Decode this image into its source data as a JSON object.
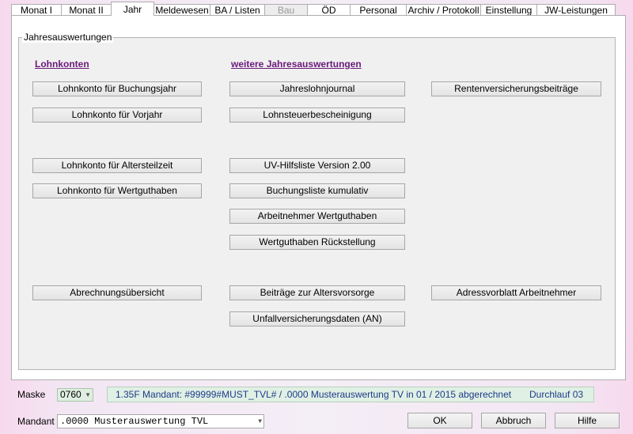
{
  "tabs": [
    {
      "label": "Monat I"
    },
    {
      "label": "Monat II"
    },
    {
      "label": "Jahr"
    },
    {
      "label": "Meldewesen"
    },
    {
      "label": "BA / Listen"
    },
    {
      "label": "Bau"
    },
    {
      "label": "ÖD"
    },
    {
      "label": "Personal"
    },
    {
      "label": "Archiv / Protokoll"
    },
    {
      "label": "Einstellung"
    },
    {
      "label": "JW-Leistungen"
    }
  ],
  "group": {
    "title": "Jahresauswertungen"
  },
  "sections": {
    "lohnkonten": "Lohnkonten",
    "weitere": "weitere Jahresauswertungen"
  },
  "buttons": {
    "lk_buchungsjahr": "Lohnkonto für Buchungsjahr",
    "lk_vorjahr": "Lohnkonto für Vorjahr",
    "lk_altersteilzeit": "Lohnkonto für Altersteilzeit",
    "lk_wertguthaben": "Lohnkonto für Wertguthaben",
    "abrechnungsuebersicht": "Abrechnungsübersicht",
    "jahreslohnjournal": "Jahreslohnjournal",
    "lohnsteuerbescheinigung": "Lohnsteuerbescheinigung",
    "uv_hilfsliste": "UV-Hilfsliste Version 2.00",
    "buchungsliste": "Buchungsliste kumulativ",
    "an_wertguthaben": "Arbeitnehmer Wertguthaben",
    "wg_rueckstellung": "Wertguthaben Rückstellung",
    "altersvorsorge": "Beiträge zur Altersvorsorge",
    "unfallversicherung": "Unfallversicherungsdaten (AN)",
    "rentenversicherung": "Rentenversicherungsbeiträge",
    "adressvorblatt": "Adressvorblatt Arbeitnehmer"
  },
  "status": {
    "maske_label": "Maske",
    "maske_value": "0760",
    "info": "1.35F Mandant: #99999#MUST_TVL# / .0000 Musterauswertung TV in 01 / 2015 abgerechnet",
    "durchlauf": "Durchlauf 03",
    "mandant_label": "Mandant",
    "mandant_value": ".0000 Musterauswertung TVL"
  },
  "footer": {
    "ok": "OK",
    "abbruch": "Abbruch",
    "hilfe": "Hilfe"
  }
}
